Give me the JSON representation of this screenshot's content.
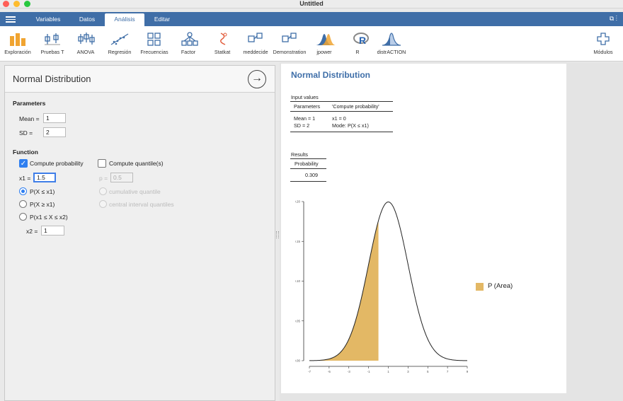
{
  "window": {
    "title": "Untitled"
  },
  "tabs": [
    {
      "label": "Variables"
    },
    {
      "label": "Datos"
    },
    {
      "label": "Análisis"
    },
    {
      "label": "Editar"
    }
  ],
  "ribbon": [
    {
      "label": "Exploración",
      "icon": "exploration-icon"
    },
    {
      "label": "Pruebas T",
      "icon": "t-tests-icon"
    },
    {
      "label": "ANOVA",
      "icon": "anova-icon"
    },
    {
      "label": "Regresión",
      "icon": "regression-icon"
    },
    {
      "label": "Frecuencias",
      "icon": "frequencies-icon"
    },
    {
      "label": "Factor",
      "icon": "factor-icon"
    },
    {
      "label": "Statkat",
      "icon": "statkat-icon"
    },
    {
      "label": "meddecide",
      "icon": "meddecide-icon"
    },
    {
      "label": "Demonstration",
      "icon": "demonstration-icon"
    },
    {
      "label": "jpower",
      "icon": "jpower-icon"
    },
    {
      "label": "R",
      "icon": "r-icon"
    },
    {
      "label": "distrACTION",
      "icon": "distraction-icon"
    },
    {
      "label": "Módulos",
      "icon": "plus-icon"
    }
  ],
  "left_panel": {
    "title": "Normal Distribution",
    "parameters_title": "Parameters",
    "mean_label": "Mean =",
    "mean_value": "1",
    "sd_label": "SD =",
    "sd_value": "2",
    "function_title": "Function",
    "compute_probability_label": "Compute probability",
    "compute_quantile_label": "Compute quantile(s)",
    "x1_label": "x1 =",
    "x1_value": "1.5",
    "p_label": "p =",
    "p_value": "0.5",
    "radio_le": "P(X ≤ x1)",
    "radio_ge": "P(X ≥ x1)",
    "radio_between": "P(x1 ≤ X ≤ x2)",
    "cumulative_quantile": "cumulative quantile",
    "central_interval": "central interval quantiles",
    "x2_label": "x2 =",
    "x2_value": "1"
  },
  "results": {
    "title": "Normal Distribution",
    "input_values_title": "Input values",
    "col_parameters": "Parameters",
    "col_compute": "'Compute probability'",
    "mean_cell": "Mean = 1",
    "sd_cell": "SD = 2",
    "x1_cell": "x1 = 0",
    "mode_cell": "Mode: P(X ≤ x1)",
    "results_title": "Results",
    "col_probability": "Probability",
    "probability_value": "0.309",
    "legend_label": "P (Area)"
  },
  "chart_data": {
    "type": "area",
    "title": "",
    "xlabel": "",
    "ylabel": "",
    "mean": 1,
    "sd": 2,
    "shaded_upper": 0,
    "x_ticks": [
      -7,
      -5,
      -3,
      -1,
      1,
      3,
      5,
      7,
      9
    ],
    "y_ticks": [
      0.0,
      0.05,
      0.1,
      0.15,
      0.2
    ],
    "xlim": [
      -7,
      9
    ],
    "ylim": [
      0,
      0.2
    ],
    "legend": [
      {
        "name": "P (Area)",
        "color": "#e3b865"
      }
    ],
    "legend_position": "right",
    "grid": false
  },
  "colors": {
    "accent": "#3f6ea7",
    "title_blue": "#3e6ea8",
    "area_fill": "#e3b865",
    "checkbox_blue": "#2f7ff0"
  }
}
